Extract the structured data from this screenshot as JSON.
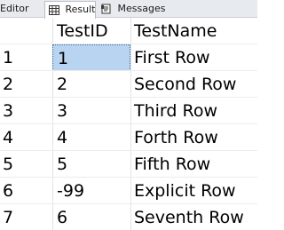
{
  "tabs": {
    "editor": "Editor",
    "results": "Results",
    "messages": "Messages"
  },
  "grid": {
    "columns": [
      "",
      "TestID",
      "TestName"
    ],
    "rows": [
      {
        "num": "1",
        "id": "1",
        "name": "First Row"
      },
      {
        "num": "2",
        "id": "2",
        "name": "Second Row"
      },
      {
        "num": "3",
        "id": "3",
        "name": "Third Row"
      },
      {
        "num": "4",
        "id": "4",
        "name": "Forth Row"
      },
      {
        "num": "5",
        "id": "5",
        "name": "Fifth Row"
      },
      {
        "num": "6",
        "id": "-99",
        "name": "Explicit Row"
      },
      {
        "num": "7",
        "id": "6",
        "name": "Seventh Row"
      }
    ]
  },
  "colors": {
    "selected_cell": "#b8d4f0",
    "tabbar": "#e7eaee"
  },
  "icons": {
    "results_tab": "grid-icon",
    "messages_tab": "messages-icon"
  }
}
